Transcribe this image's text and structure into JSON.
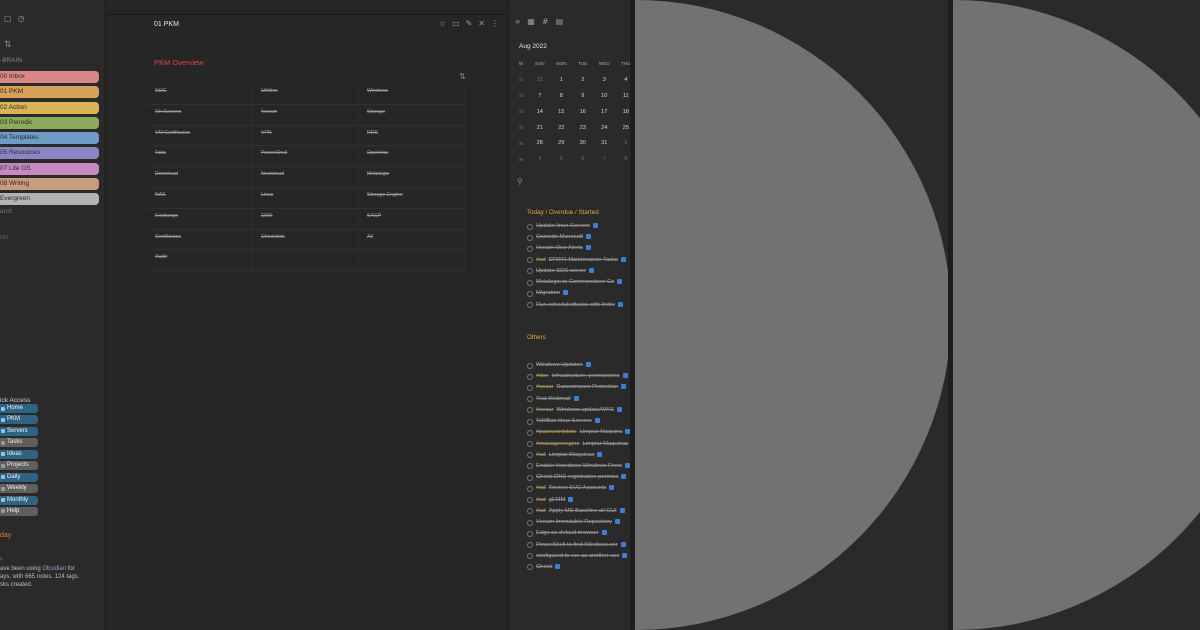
{
  "sidebar": {
    "vault_label": "-BRAIN",
    "folders": [
      {
        "label": "00 Inbox",
        "color": "#d98686"
      },
      {
        "label": "01 PKM",
        "color": "#d6a25a"
      },
      {
        "label": "02 Action",
        "color": "#d8b457"
      },
      {
        "label": "03 Periodic",
        "color": "#8aaa5c"
      },
      {
        "label": "04 Templates",
        "color": "#6f9bc7"
      },
      {
        "label": "05 Resources",
        "color": "#8a86c6"
      },
      {
        "label": "07 Life OS",
        "color": "#c489c0"
      },
      {
        "label": "08 Writing",
        "color": "#c99b7e"
      },
      {
        "label": "Evergreen",
        "color": "#b3b3b3"
      }
    ],
    "search_label": "arch",
    "shortcuts_label": "uts",
    "quick_access": {
      "title": "ick Access",
      "buttons": [
        {
          "label": "Home",
          "style": "blue"
        },
        {
          "label": "PKM",
          "style": "blue"
        },
        {
          "label": "Servers",
          "style": "blue"
        },
        {
          "label": "Tasks",
          "style": "grey"
        },
        {
          "label": "Ideas",
          "style": "blue"
        },
        {
          "label": "Projects",
          "style": "grey"
        },
        {
          "label": "Daily",
          "style": "blue"
        },
        {
          "label": "Weekly",
          "style": "grey"
        },
        {
          "label": "Monthly",
          "style": "blue"
        },
        {
          "label": "Help",
          "style": "grey"
        }
      ]
    },
    "today_label": "day",
    "stats_label": "s",
    "stats_text_1": "ave been using ",
    "stats_link": "Obsidian",
    "stats_text_2": " for",
    "stats_text_3": "ays, with 665 notes. 124 tags.",
    "stats_text_4": "sks created."
  },
  "editor": {
    "note_title": "01 PKM",
    "overview_title": "PKM Overview",
    "grid": [
      "NOC",
      "Utilities",
      "Windows",
      "On Servers",
      "Veeam",
      "Storage",
      "VM Certificates",
      "VPN",
      "RDS",
      "Tabs",
      "PowerShell",
      "OpenVas",
      "Download",
      "Nextcloud",
      "Metalogix",
      "NAS",
      "Linux",
      "Storage Engine",
      "Exchange",
      "CMS",
      "SACP",
      "Certificates",
      "Checklists",
      "All",
      "Audit",
      "",
      ""
    ]
  },
  "calendar": {
    "month": "Aug 2022",
    "headers": [
      "W",
      "SUN",
      "MON",
      "TUE",
      "WED",
      "THU"
    ],
    "weeks": [
      {
        "wk": "31",
        "days": [
          "31",
          "1",
          "2",
          "3",
          "4"
        ]
      },
      {
        "wk": "32",
        "days": [
          "7",
          "8",
          "9",
          "10",
          "11"
        ]
      },
      {
        "wk": "33",
        "days": [
          "14",
          "15",
          "16",
          "17",
          "18"
        ]
      },
      {
        "wk": "34",
        "days": [
          "21",
          "22",
          "23",
          "24",
          "25"
        ]
      },
      {
        "wk": "35",
        "days": [
          "28",
          "29",
          "30",
          "31",
          "1"
        ]
      },
      {
        "wk": "36",
        "days": [
          "4",
          "5",
          "6",
          "7",
          "8"
        ]
      }
    ]
  },
  "tasks": {
    "heading_today": "Today / Overdue / Started",
    "heading_others": "Others",
    "today": [
      {
        "tag": "",
        "text": "Update linux Servers"
      },
      {
        "tag": "",
        "text": "Comodo Microsoft"
      },
      {
        "tag": "",
        "text": "Veeam One Alerts"
      },
      {
        "tag": "#ad",
        "text": "DR001 Maintenance Tasks"
      },
      {
        "tag": "",
        "text": "Update SDS server"
      },
      {
        "tag": "",
        "text": "Metalogix to Commonstore Co"
      },
      {
        "tag": "",
        "text": "Migration"
      },
      {
        "tag": "",
        "text": "Run scheduledtasks with linktv"
      }
    ],
    "others": [
      {
        "tag": "",
        "text": "Windows Updates"
      },
      {
        "tag": "#dev",
        "text": "infrastructure, permissions"
      },
      {
        "tag": "#secur",
        "text": "Ransomware Protection"
      },
      {
        "tag": "",
        "text": "Test Webmail"
      },
      {
        "tag": "#secur",
        "text": "Windows update/WKS"
      },
      {
        "tag": "",
        "text": "Tell/Ban linux Servers"
      },
      {
        "tag": "#passwordstate",
        "text": "Limpiar Maquina"
      },
      {
        "tag": "#managerengine",
        "text": "Limpiar Maquinas"
      },
      {
        "tag": "#ad",
        "text": "Limpiar Maquinas"
      },
      {
        "tag": "",
        "text": "Enable #windows Windows Firew"
      },
      {
        "tag": "",
        "text": "Check DNS registration permiss"
      },
      {
        "tag": "#ad",
        "text": "Review SVC Accounts"
      },
      {
        "tag": "#ad",
        "text": "gEMM"
      },
      {
        "tag": "#ad",
        "text": "Apply MS Baseline all GUI"
      },
      {
        "tag": "",
        "text": "Veeam Immutable Repository"
      },
      {
        "tag": "",
        "text": "Edge as default browser"
      },
      {
        "tag": "",
        "text": "PowerShell to find Windows ser"
      },
      {
        "tag": "",
        "text": "configured to run as another use"
      },
      {
        "tag": "",
        "text": "Check"
      }
    ]
  },
  "colors": {
    "accent_red": "#d9484e",
    "heading_orange": "#e8a33a",
    "quick_access_blue": "#2f6383",
    "circle_grey": "#727272"
  }
}
